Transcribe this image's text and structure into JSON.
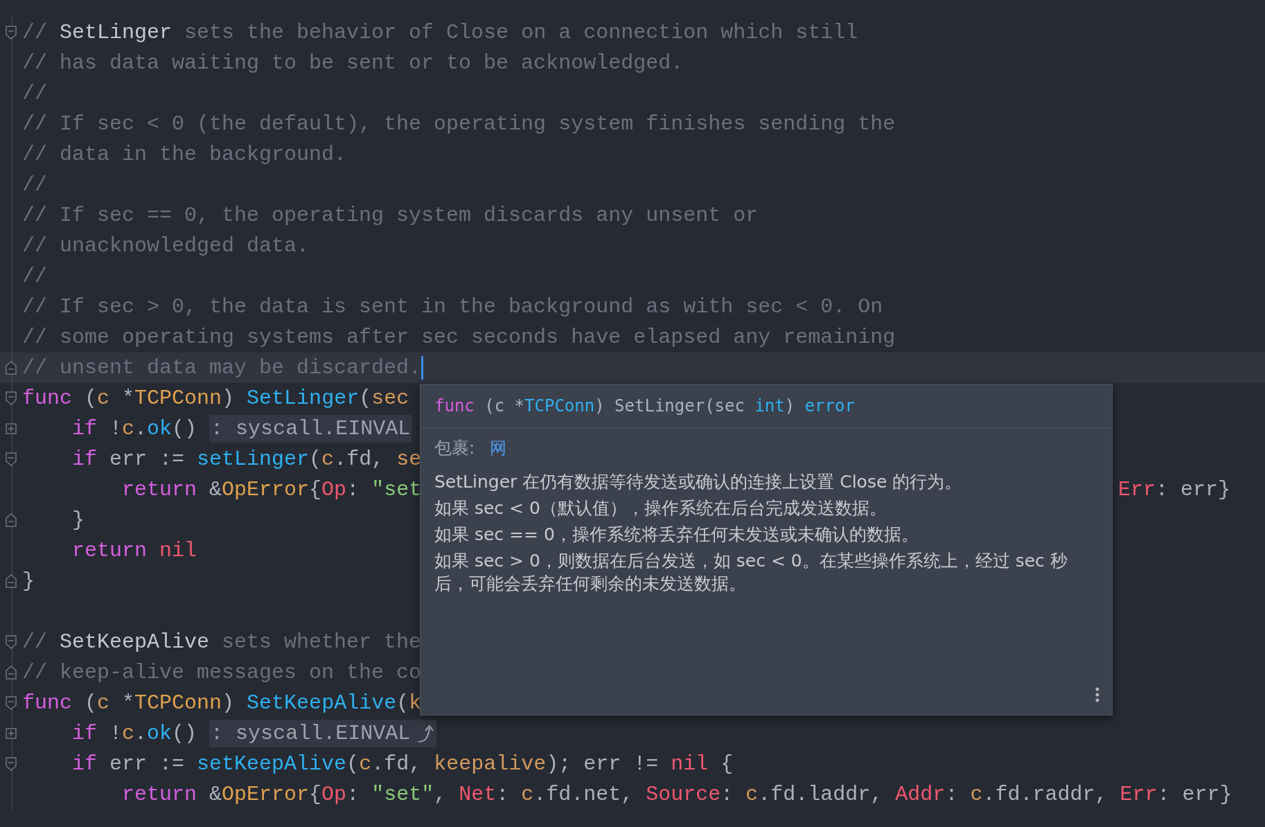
{
  "editor": {
    "lines": [
      {
        "gutter": {
          "kind": "fold-start"
        },
        "current": false,
        "segments": [
          {
            "kind": "code",
            "tokens": [
              {
                "kind": "comment",
                "text": "// "
              },
              {
                "kind": "doc",
                "text": "SetLinger"
              },
              {
                "kind": "comment",
                "text": " sets the behavior of Close on a connection which still"
              }
            ]
          }
        ]
      },
      {
        "current": false,
        "segments": [
          {
            "kind": "code",
            "tokens": [
              {
                "kind": "comment",
                "text": "// has data waiting to be sent or to be acknowledged."
              }
            ]
          }
        ]
      },
      {
        "current": false,
        "segments": [
          {
            "kind": "code",
            "tokens": [
              {
                "kind": "comment",
                "text": "//"
              }
            ]
          }
        ]
      },
      {
        "current": false,
        "segments": [
          {
            "kind": "code",
            "tokens": [
              {
                "kind": "comment",
                "text": "// If sec < 0 (the default), the operating system finishes sending the"
              }
            ]
          }
        ]
      },
      {
        "current": false,
        "segments": [
          {
            "kind": "code",
            "tokens": [
              {
                "kind": "comment",
                "text": "// data in the background."
              }
            ]
          }
        ]
      },
      {
        "current": false,
        "segments": [
          {
            "kind": "code",
            "tokens": [
              {
                "kind": "comment",
                "text": "//"
              }
            ]
          }
        ]
      },
      {
        "current": false,
        "segments": [
          {
            "kind": "code",
            "tokens": [
              {
                "kind": "comment",
                "text": "// If sec == 0, the operating system discards any unsent or"
              }
            ]
          }
        ]
      },
      {
        "current": false,
        "segments": [
          {
            "kind": "code",
            "tokens": [
              {
                "kind": "comment",
                "text": "// unacknowledged data."
              }
            ]
          }
        ]
      },
      {
        "current": false,
        "segments": [
          {
            "kind": "code",
            "tokens": [
              {
                "kind": "comment",
                "text": "//"
              }
            ]
          }
        ]
      },
      {
        "current": false,
        "segments": [
          {
            "kind": "code",
            "tokens": [
              {
                "kind": "comment",
                "text": "// If sec > 0, the data is sent in the background as with sec < 0. On"
              }
            ]
          }
        ]
      },
      {
        "current": false,
        "segments": [
          {
            "kind": "code",
            "tokens": [
              {
                "kind": "comment",
                "text": "// some operating systems after sec seconds have elapsed any remaining"
              }
            ]
          }
        ]
      },
      {
        "gutter": {
          "kind": "fold-end"
        },
        "current": true,
        "segments": [
          {
            "kind": "code",
            "tokens": [
              {
                "kind": "comment",
                "text": "// unsent data may be discarded."
              }
            ]
          }
        ]
      },
      {
        "gutter": {
          "kind": "fold-start"
        },
        "current": false,
        "segments": [
          {
            "kind": "code",
            "tokens": [
              {
                "kind": "kw",
                "text": "func"
              },
              {
                "kind": "plain",
                "text": " ("
              },
              {
                "kind": "var",
                "text": "c"
              },
              {
                "kind": "plain",
                "text": " *"
              },
              {
                "kind": "type",
                "text": "TCPConn"
              },
              {
                "kind": "plain",
                "text": ") "
              },
              {
                "kind": "fn",
                "text": "SetLinger"
              },
              {
                "kind": "plain",
                "text": "("
              },
              {
                "kind": "var",
                "text": "sec"
              }
            ]
          }
        ]
      },
      {
        "gutter": {
          "kind": "collapsed"
        },
        "current": false,
        "segments": [
          {
            "kind": "code",
            "tokens": [
              {
                "kind": "kw",
                "text": "    if"
              },
              {
                "kind": "plain",
                "text": " !"
              },
              {
                "kind": "var",
                "text": "c"
              },
              {
                "kind": "plain",
                "text": "."
              },
              {
                "kind": "fn",
                "text": "ok"
              },
              {
                "kind": "plain",
                "text": "() "
              }
            ]
          },
          {
            "kind": "folded",
            "tokens": [
              {
                "kind": "plain",
                "text": ": syscall.EINVAL"
              }
            ]
          }
        ]
      },
      {
        "gutter": {
          "kind": "fold-start"
        },
        "current": false,
        "segments": [
          {
            "kind": "code",
            "tokens": [
              {
                "kind": "kw",
                "text": "    if"
              },
              {
                "kind": "plain",
                "text": " err := "
              },
              {
                "kind": "fn",
                "text": "setLinger"
              },
              {
                "kind": "plain",
                "text": "("
              },
              {
                "kind": "var",
                "text": "c"
              },
              {
                "kind": "plain",
                "text": ".fd, "
              },
              {
                "kind": "var",
                "text": "se"
              }
            ]
          }
        ]
      },
      {
        "current": false,
        "segments": [
          {
            "kind": "code",
            "tokens": [
              {
                "kind": "kw",
                "text": "        return"
              },
              {
                "kind": "plain",
                "text": " &"
              },
              {
                "kind": "type",
                "text": "OpError"
              },
              {
                "kind": "plain",
                "text": "{"
              },
              {
                "kind": "field",
                "text": "Op"
              },
              {
                "kind": "plain",
                "text": ": "
              },
              {
                "kind": "str",
                "text": "\"set"
              }
            ]
          },
          {
            "kind": "right",
            "tokens": [
              {
                "kind": "field",
                "text": "Err"
              },
              {
                "kind": "plain",
                "text": ": err}"
              }
            ]
          }
        ]
      },
      {
        "gutter": {
          "kind": "fold-end"
        },
        "current": false,
        "segments": [
          {
            "kind": "code",
            "tokens": [
              {
                "kind": "plain",
                "text": "    }"
              }
            ]
          }
        ]
      },
      {
        "current": false,
        "segments": [
          {
            "kind": "code",
            "tokens": [
              {
                "kind": "kw",
                "text": "    return"
              },
              {
                "kind": "nil",
                "text": " nil"
              }
            ]
          }
        ]
      },
      {
        "gutter": {
          "kind": "fold-end"
        },
        "current": false,
        "segments": [
          {
            "kind": "code",
            "tokens": [
              {
                "kind": "plain",
                "text": "}"
              }
            ]
          }
        ]
      },
      {
        "current": false
      },
      {
        "gutter": {
          "kind": "fold-start"
        },
        "current": false,
        "segments": [
          {
            "kind": "code",
            "tokens": [
              {
                "kind": "comment",
                "text": "// "
              },
              {
                "kind": "doc",
                "text": "SetKeepAlive"
              },
              {
                "kind": "comment",
                "text": " sets whether the"
              }
            ]
          }
        ]
      },
      {
        "gutter": {
          "kind": "fold-end"
        },
        "current": false,
        "segments": [
          {
            "kind": "code",
            "tokens": [
              {
                "kind": "comment",
                "text": "// keep-alive messages on the co"
              }
            ]
          }
        ]
      },
      {
        "gutter": {
          "kind": "fold-start"
        },
        "current": false,
        "segments": [
          {
            "kind": "code",
            "tokens": [
              {
                "kind": "kw",
                "text": "func"
              },
              {
                "kind": "plain",
                "text": " ("
              },
              {
                "kind": "var",
                "text": "c"
              },
              {
                "kind": "plain",
                "text": " *"
              },
              {
                "kind": "type",
                "text": "TCPConn"
              },
              {
                "kind": "plain",
                "text": ") "
              },
              {
                "kind": "fn",
                "text": "SetKeepAlive"
              },
              {
                "kind": "plain",
                "text": "("
              },
              {
                "kind": "var",
                "text": "k"
              }
            ]
          }
        ]
      },
      {
        "gutter": {
          "kind": "collapsed"
        },
        "current": false,
        "segments": [
          {
            "kind": "code",
            "tokens": [
              {
                "kind": "kw",
                "text": "    if"
              },
              {
                "kind": "plain",
                "text": " !"
              },
              {
                "kind": "var",
                "text": "c"
              },
              {
                "kind": "plain",
                "text": "."
              },
              {
                "kind": "fn",
                "text": "ok"
              },
              {
                "kind": "plain",
                "text": "() "
              }
            ]
          },
          {
            "kind": "folded",
            "arrow": true,
            "tokens": [
              {
                "kind": "plain",
                "text": ": syscall.EINVAL"
              }
            ]
          }
        ]
      },
      {
        "gutter": {
          "kind": "fold-start"
        },
        "current": false,
        "segments": [
          {
            "kind": "code",
            "tokens": [
              {
                "kind": "kw",
                "text": "    if"
              },
              {
                "kind": "plain",
                "text": " err := "
              },
              {
                "kind": "fn",
                "text": "setKeepAlive"
              },
              {
                "kind": "plain",
                "text": "("
              },
              {
                "kind": "var",
                "text": "c"
              },
              {
                "kind": "plain",
                "text": ".fd, "
              },
              {
                "kind": "var",
                "text": "keepalive"
              },
              {
                "kind": "plain",
                "text": "); err != "
              },
              {
                "kind": "nil",
                "text": "nil"
              },
              {
                "kind": "plain",
                "text": " {"
              }
            ]
          }
        ]
      },
      {
        "current": false,
        "segments": [
          {
            "kind": "code",
            "tokens": [
              {
                "kind": "kw",
                "text": "        return"
              },
              {
                "kind": "plain",
                "text": " &"
              },
              {
                "kind": "type",
                "text": "OpError"
              },
              {
                "kind": "plain",
                "text": "{"
              },
              {
                "kind": "field",
                "text": "Op"
              },
              {
                "kind": "plain",
                "text": ": "
              },
              {
                "kind": "str",
                "text": "\"set\""
              },
              {
                "kind": "plain",
                "text": ", "
              },
              {
                "kind": "field",
                "text": "Net"
              },
              {
                "kind": "plain",
                "text": ": "
              },
              {
                "kind": "var",
                "text": "c"
              },
              {
                "kind": "plain",
                "text": ".fd.net, "
              },
              {
                "kind": "field",
                "text": "Source"
              },
              {
                "kind": "plain",
                "text": ": "
              },
              {
                "kind": "var",
                "text": "c"
              },
              {
                "kind": "plain",
                "text": ".fd.laddr, "
              },
              {
                "kind": "field",
                "text": "Addr"
              },
              {
                "kind": "plain",
                "text": ": "
              },
              {
                "kind": "var",
                "text": "c"
              },
              {
                "kind": "plain",
                "text": ".fd.raddr, "
              },
              {
                "kind": "field",
                "text": "Err"
              },
              {
                "kind": "plain",
                "text": ": err}"
              }
            ]
          }
        ]
      }
    ]
  },
  "popup": {
    "signature": [
      {
        "kind": "kw",
        "text": "func"
      },
      {
        "kind": "plain",
        "text": " (c *"
      },
      {
        "kind": "fn",
        "text": "TCPConn"
      },
      {
        "kind": "plain",
        "text": ") SetLinger(sec "
      },
      {
        "kind": "fn",
        "text": "int"
      },
      {
        "kind": "plain",
        "text": ") "
      },
      {
        "kind": "fn",
        "text": "error"
      }
    ],
    "package_label": "包裹:",
    "package_name": "网",
    "description": [
      "SetLinger 在仍有数据等待发送或确认的连接上设置 Close 的行为。",
      "如果 sec < 0（默认值），操作系统在后台完成发送数据。",
      "如果 sec == 0，操作系统将丢弃任何未发送或未确认的数据。",
      "如果 sec > 0，则数据在后台发送，如 sec < 0。在某些操作系统上，经过 sec 秒后，可能会丢弃任何剩余的未发送数据。"
    ]
  }
}
